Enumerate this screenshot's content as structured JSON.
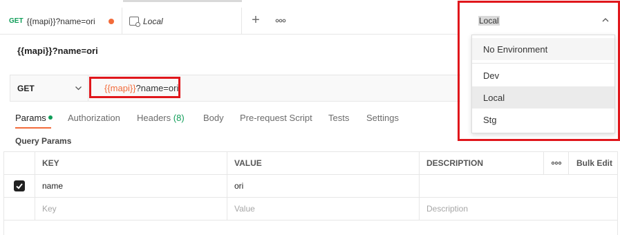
{
  "tabs": {
    "request_tab": {
      "method": "GET",
      "name": "{{mapi}}?name=ori"
    },
    "env_tab": {
      "name": "Local"
    },
    "new_tab_icon": "plus-icon",
    "more_icon": "ellipsis-icon"
  },
  "environment": {
    "selected": "Local",
    "options": [
      "No Environment",
      "Dev",
      "Local",
      "Stg"
    ]
  },
  "request": {
    "title": "{{mapi}}?name=ori",
    "method": "GET",
    "url_variable": "{{mapi}}",
    "url_rest": "?name=ori"
  },
  "subtabs": {
    "params": "Params",
    "authorization": "Authorization",
    "headers": "Headers",
    "headers_count": "(8)",
    "body": "Body",
    "prerequest": "Pre-request Script",
    "tests": "Tests",
    "settings": "Settings"
  },
  "query_params": {
    "label": "Query Params",
    "columns": {
      "key": "KEY",
      "value": "VALUE",
      "description": "DESCRIPTION",
      "bulk_edit": "Bulk Edit"
    },
    "rows": [
      {
        "checked": true,
        "key": "name",
        "value": "ori",
        "description": ""
      }
    ],
    "placeholders": {
      "key": "Key",
      "value": "Value",
      "description": "Description"
    }
  },
  "colors": {
    "accent": "#f26b3a",
    "green": "#0f9d58",
    "highlight": "#e0161b"
  }
}
